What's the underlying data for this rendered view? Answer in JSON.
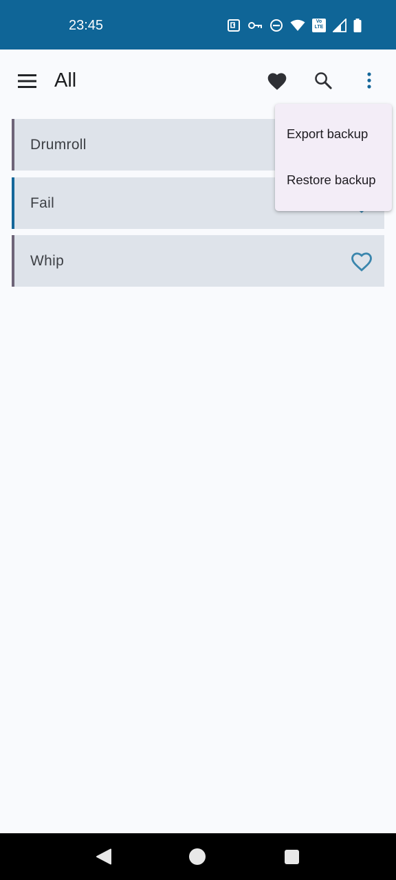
{
  "status_bar": {
    "time": "23:45",
    "icons": [
      "nfc-icon",
      "vpn-key-icon",
      "do-not-disturb-icon",
      "wifi-icon",
      "volte-icon",
      "cell-signal-icon",
      "battery-icon"
    ],
    "volte_text": "Vo LTE"
  },
  "app_bar": {
    "title": "All",
    "icons": [
      "menu-icon",
      "favorite-filled-icon",
      "search-icon",
      "more-vert-icon"
    ]
  },
  "list": {
    "items": [
      {
        "label": "Drumroll",
        "accent": "#6e6478"
      },
      {
        "label": "Fail",
        "accent": "#15679a"
      },
      {
        "label": "Whip",
        "accent": "#6e6478"
      }
    ]
  },
  "overflow_menu": {
    "items": [
      {
        "label": "Export backup"
      },
      {
        "label": "Restore backup"
      }
    ]
  },
  "nav_bar": {
    "icons": [
      "back-icon",
      "home-icon",
      "recents-icon"
    ]
  },
  "colors": {
    "status_bar": "#0f6597",
    "background": "#f9fafd",
    "list_item_bg": "#dee3ea",
    "heart_outline": "#3a86ad",
    "menu_bg": "#f3edf7"
  }
}
